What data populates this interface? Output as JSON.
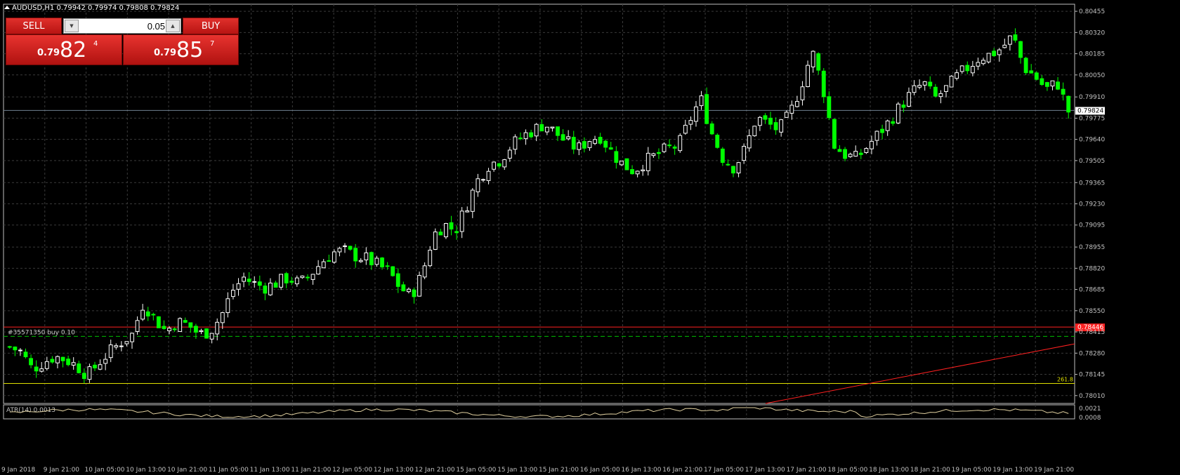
{
  "window": {
    "title": "AUDUSD,H1  0.79942 0.79974 0.79808 0.79824"
  },
  "trade_panel": {
    "sell_label": "SELL",
    "buy_label": "BUY",
    "lot_value": "0.05",
    "sell_price": {
      "prefix": "0.79",
      "big": "82",
      "small": "4"
    },
    "buy_price": {
      "prefix": "0.79",
      "big": "85",
      "small": "7"
    }
  },
  "order_line": {
    "label": "#35571350 buy 0.10",
    "price": 0.78387,
    "color": "#00c000"
  },
  "red_line": {
    "price": 0.78446,
    "label": "0.78446",
    "color": "#ff2020"
  },
  "current_price": {
    "price": 0.79824,
    "label": "0.79824"
  },
  "fibo_line": {
    "price": 0.78087,
    "label": "261.8",
    "color": "#e0e000"
  },
  "indicator": {
    "title": "ATR(14) 0.0013",
    "ticks": [
      "0.0021",
      "0.0008"
    ]
  },
  "colors": {
    "background": "#000000",
    "grid": "#3a3a3a",
    "bull": "#ffffff",
    "bear": "#00ff00",
    "axis": "#c0c0c0"
  },
  "chart_data": {
    "type": "candlestick",
    "symbol": "AUDUSD",
    "timeframe": "H1",
    "ylim": [
      0.7796,
      0.805
    ],
    "y_ticks": [
      "0.80455",
      "0.80320",
      "0.80185",
      "0.80050",
      "0.79910",
      "0.79775",
      "0.79640",
      "0.79505",
      "0.79365",
      "0.79230",
      "0.79095",
      "0.78955",
      "0.78820",
      "0.78685",
      "0.78550",
      "0.78415",
      "0.78280",
      "0.78145",
      "0.78010"
    ],
    "x_ticks": [
      "9 Jan 2018",
      "9 Jan 21:00",
      "10 Jan 05:00",
      "10 Jan 13:00",
      "10 Jan 21:00",
      "11 Jan 05:00",
      "11 Jan 13:00",
      "11 Jan 21:00",
      "12 Jan 05:00",
      "12 Jan 13:00",
      "12 Jan 21:00",
      "15 Jan 05:00",
      "15 Jan 13:00",
      "15 Jan 21:00",
      "16 Jan 05:00",
      "16 Jan 13:00",
      "16 Jan 21:00",
      "17 Jan 05:00",
      "17 Jan 13:00",
      "17 Jan 21:00",
      "18 Jan 05:00",
      "18 Jan 13:00",
      "18 Jan 21:00",
      "19 Jan 05:00",
      "19 Jan 13:00",
      "19 Jan 21:00"
    ],
    "close_path": [
      0.7832,
      0.7829,
      0.7818,
      0.7822,
      0.7826,
      0.7824,
      0.782,
      0.7814,
      0.7822,
      0.7829,
      0.7835,
      0.784,
      0.786,
      0.785,
      0.7842,
      0.7848,
      0.7846,
      0.784,
      0.7842,
      0.7852,
      0.7868,
      0.7876,
      0.7872,
      0.787,
      0.7873,
      0.7876,
      0.7872,
      0.7878,
      0.7886,
      0.7892,
      0.7893,
      0.789,
      0.7888,
      0.7884,
      0.788,
      0.787,
      0.7864,
      0.7878,
      0.7903,
      0.791,
      0.7906,
      0.7922,
      0.7938,
      0.7948,
      0.7951,
      0.796,
      0.7966,
      0.797,
      0.7974,
      0.7968,
      0.7962,
      0.7958,
      0.7964,
      0.7966,
      0.7956,
      0.7948,
      0.7944,
      0.795,
      0.7954,
      0.7958,
      0.796,
      0.7976,
      0.799,
      0.7968,
      0.7952,
      0.7946,
      0.7958,
      0.7978,
      0.7974,
      0.797,
      0.798,
      0.7998,
      0.802,
      0.7996,
      0.796,
      0.7954,
      0.7952,
      0.796,
      0.7968,
      0.7976,
      0.7986,
      0.7994,
      0.8,
      0.799,
      0.7996,
      0.8004,
      0.801,
      0.8016,
      0.8018,
      0.8022,
      0.803,
      0.801,
      0.8004,
      0.7996,
      0.8,
      0.7982
    ]
  }
}
